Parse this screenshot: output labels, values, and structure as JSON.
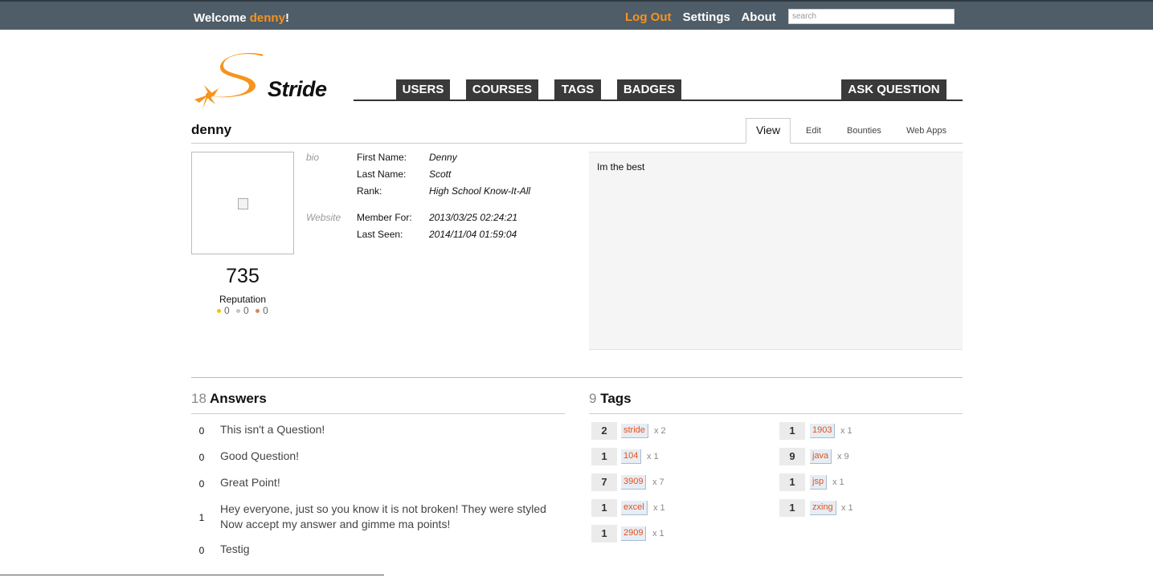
{
  "topbar": {
    "welcome_prefix": "Welcome ",
    "username": "denny",
    "welcome_suffix": "!",
    "links": {
      "logout": "Log Out",
      "settings": "Settings",
      "about": "About"
    },
    "search_placeholder": "search"
  },
  "brand": {
    "name": "Stride",
    "accent_color": "#f7941d"
  },
  "nav": {
    "users": "USERS",
    "courses": "COURSES",
    "tags": "TAGS",
    "badges": "BADGES",
    "ask": "ASK QUESTION"
  },
  "profile": {
    "username": "denny",
    "tabs": {
      "view": "View",
      "edit": "Edit",
      "bounties": "Bounties",
      "webapps": "Web Apps"
    },
    "reputation": "735",
    "reputation_label": "Reputation",
    "badges": {
      "gold": "0",
      "silver": "0",
      "bronze": "0"
    },
    "side_labels": {
      "bio": "bio",
      "website": "Website"
    },
    "fields": {
      "first_name_label": "First Name:",
      "first_name": "Denny",
      "last_name_label": "Last Name:",
      "last_name": "Scott",
      "rank_label": "Rank:",
      "rank": "High School Know-It-All",
      "member_for_label": "Member For:",
      "member_for": "2013/03/25 02:24:21",
      "last_seen_label": "Last Seen:",
      "last_seen": "2014/11/04 01:59:04"
    },
    "bio": "Im the best"
  },
  "answers": {
    "count": "18",
    "heading": "Answers",
    "items": [
      {
        "score": "0",
        "title": "This isn't a Question!"
      },
      {
        "score": "0",
        "title": "Good Question!"
      },
      {
        "score": "0",
        "title": "Great Point!"
      },
      {
        "score": "1",
        "title": "Hey everyone, just so you know it is not broken! They were styled Now accept my answer and gimme ma points!"
      },
      {
        "score": "0",
        "title": "Testig"
      }
    ]
  },
  "tags": {
    "count": "9",
    "heading": "Tags",
    "items": [
      {
        "count": "2",
        "name": "stride",
        "mult": "x  2"
      },
      {
        "count": "1",
        "name": "104",
        "mult": "x  1"
      },
      {
        "count": "7",
        "name": "3909",
        "mult": "x  7"
      },
      {
        "count": "1",
        "name": "excel",
        "mult": "x  1"
      },
      {
        "count": "1",
        "name": "2909",
        "mult": "x  1"
      },
      {
        "count": "1",
        "name": "1903",
        "mult": "x  1"
      },
      {
        "count": "9",
        "name": "java",
        "mult": "x  9"
      },
      {
        "count": "1",
        "name": "jsp",
        "mult": "x  1"
      },
      {
        "count": "1",
        "name": "zxing",
        "mult": "x  1"
      }
    ]
  }
}
